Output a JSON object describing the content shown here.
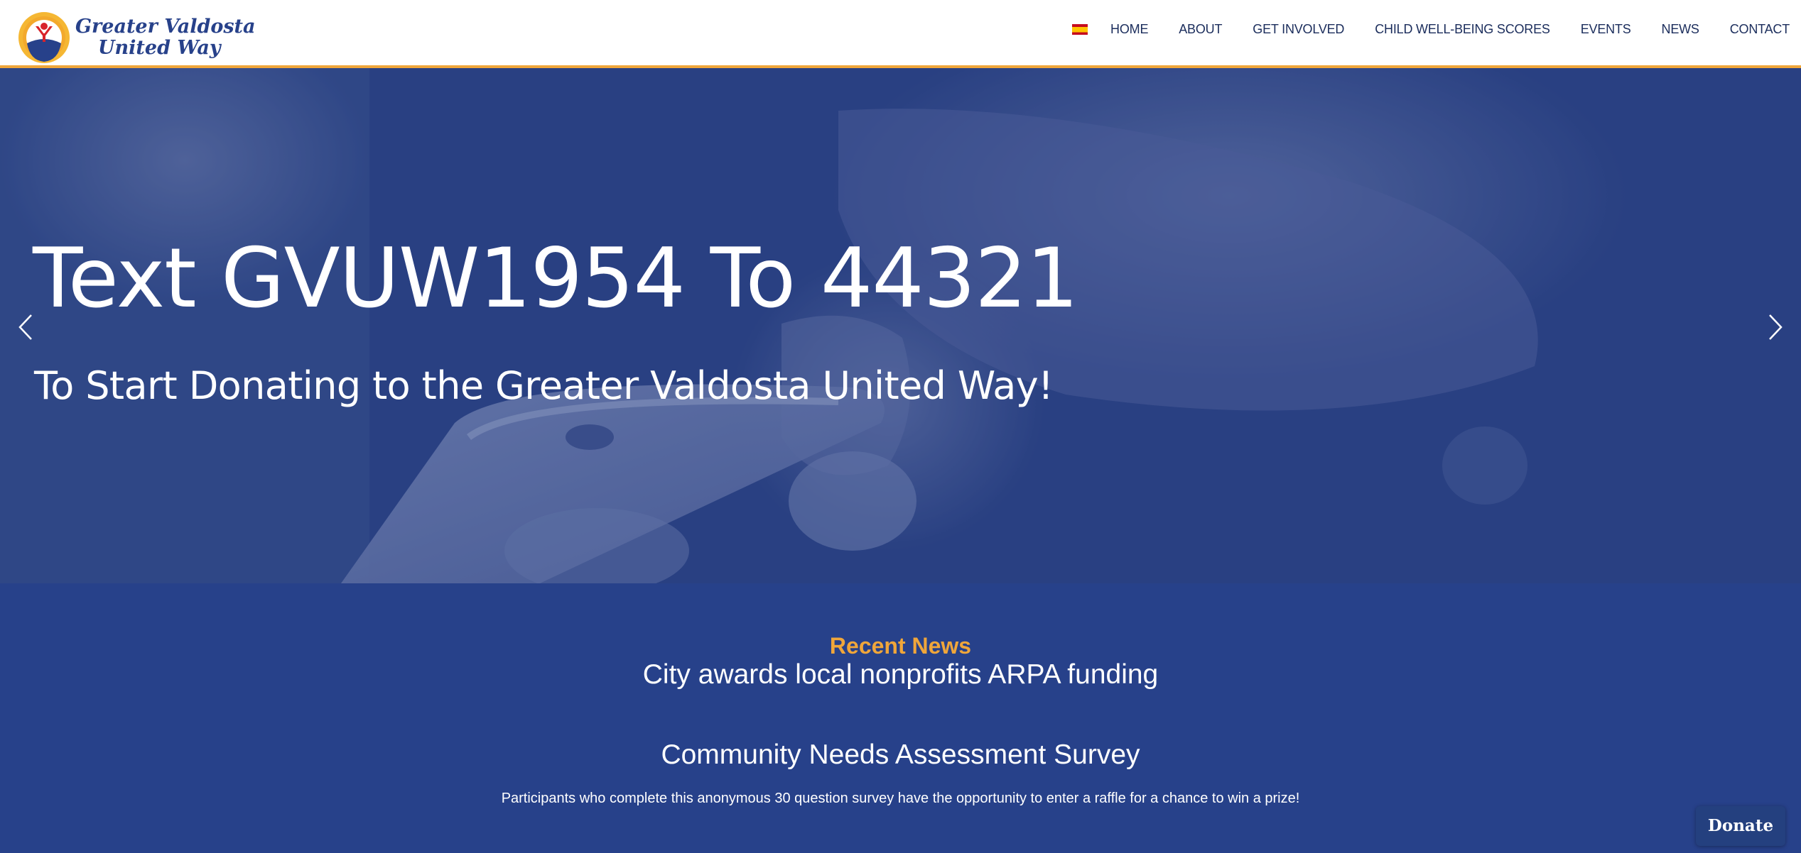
{
  "header": {
    "logo": {
      "line1": "Greater Valdosta",
      "line2": "United Way"
    },
    "language_flag": "spanish-flag-icon",
    "nav": [
      {
        "label": "HOME"
      },
      {
        "label": "ABOUT"
      },
      {
        "label": "GET INVOLVED"
      },
      {
        "label": "CHILD WELL-BEING SCORES"
      },
      {
        "label": "EVENTS"
      },
      {
        "label": "NEWS"
      },
      {
        "label": "CONTACT"
      }
    ]
  },
  "hero": {
    "title": "Text GVUW1954 To 44321",
    "subtitle": "To Start Donating to the Greater Valdosta United Way!",
    "prev_icon": "chevron-left-icon",
    "next_icon": "chevron-right-icon"
  },
  "news": {
    "label": "Recent News",
    "headline": "City awards local nonprofits ARPA funding",
    "survey_title": "Community Needs Assessment Survey",
    "survey_description": "Participants who complete this anonymous 30 question survey have the opportunity to enter a raffle for a chance to win a prize!"
  },
  "donate_label": "Donate",
  "colors": {
    "brand_blue": "#27418a",
    "accent_orange": "#f0a63a",
    "nav_text": "#1b2d5c"
  }
}
